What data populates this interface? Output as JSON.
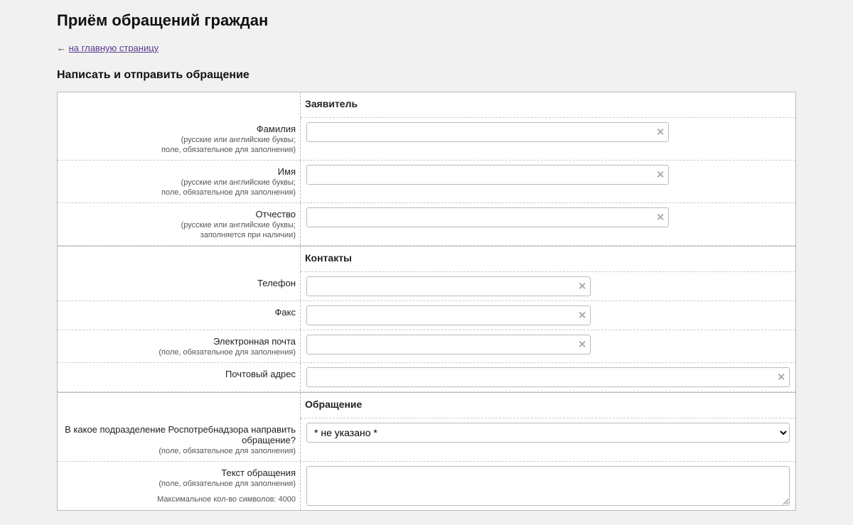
{
  "page": {
    "title": "Приём обращений граждан",
    "back_arrow": "←",
    "back_link": "на главную страницу",
    "subtitle": "Написать и отправить обращение"
  },
  "sections": {
    "applicant": {
      "header": "Заявитель",
      "surname": {
        "label": "Фамилия",
        "hint1": "(русские или английские буквы;",
        "hint2": "поле, обязательное для заполнения)",
        "value": ""
      },
      "name": {
        "label": "Имя",
        "hint1": "(русские или английские буквы;",
        "hint2": "поле, обязательное для заполнения)",
        "value": ""
      },
      "patronymic": {
        "label": "Отчество",
        "hint1": "(русские или английские буквы;",
        "hint2": "заполняется при наличии)",
        "value": ""
      }
    },
    "contacts": {
      "header": "Контакты",
      "phone": {
        "label": "Телефон",
        "value": ""
      },
      "fax": {
        "label": "Факс",
        "value": ""
      },
      "email": {
        "label": "Электронная почта",
        "hint": "(поле, обязательное для заполнения)",
        "value": ""
      },
      "postal": {
        "label": "Почтовый адрес",
        "value": ""
      }
    },
    "appeal": {
      "header": "Обращение",
      "department": {
        "label": "В какое подразделение Роспотребнадзора направить обращение?",
        "hint": "(поле, обязательное для заполнения)",
        "selected": "* не указано *"
      },
      "text": {
        "label": "Текст обращения",
        "hint": "(поле, обязательное для заполнения)",
        "maxchars": "Максимальное кол-во символов: 4000",
        "value": ""
      }
    }
  }
}
